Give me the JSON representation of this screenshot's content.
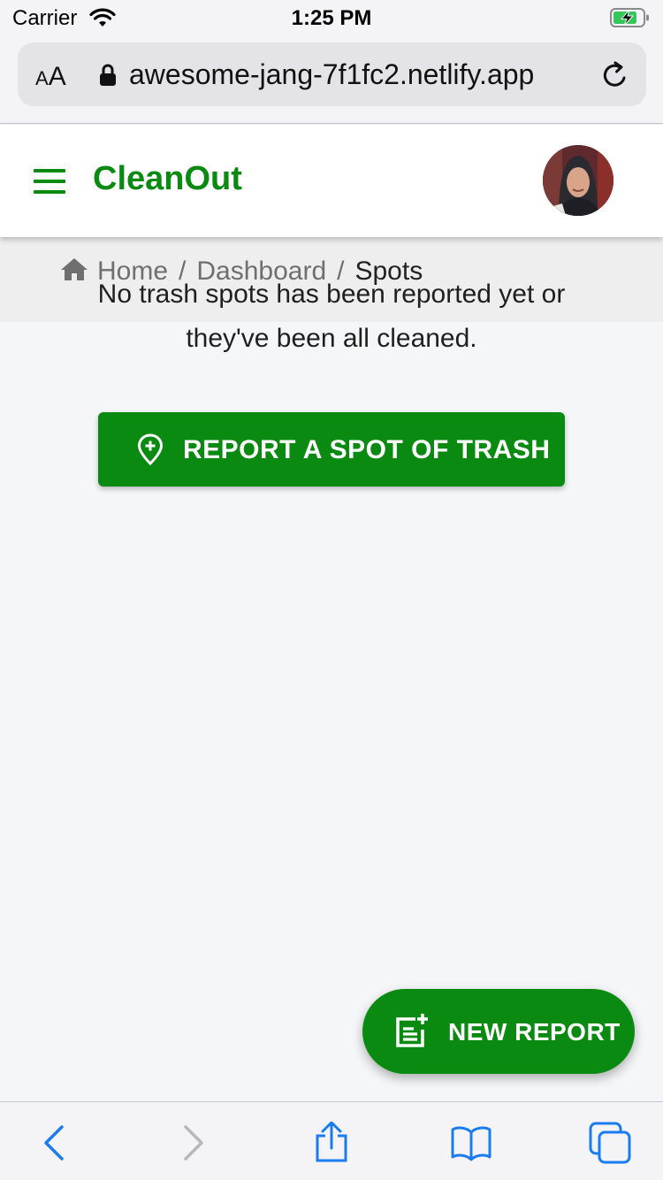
{
  "status_bar": {
    "carrier": "Carrier",
    "time": "1:25 PM"
  },
  "browser": {
    "text_size_label_small": "A",
    "text_size_label_large": "A",
    "url": "awesome-jang-7f1fc2.netlify.app"
  },
  "app_bar": {
    "brand": "CleanOut"
  },
  "breadcrumb": {
    "items": [
      "Home",
      "Dashboard",
      "Spots"
    ],
    "separator": "/"
  },
  "main": {
    "empty_message": "No trash spots has been reported yet or they've been all cleaned.",
    "report_button_label": "REPORT A SPOT OF TRASH"
  },
  "fab": {
    "label": "NEW REPORT"
  },
  "colors": {
    "brand_green": "#0a8a10",
    "ios_blue": "#1a7cf0"
  }
}
